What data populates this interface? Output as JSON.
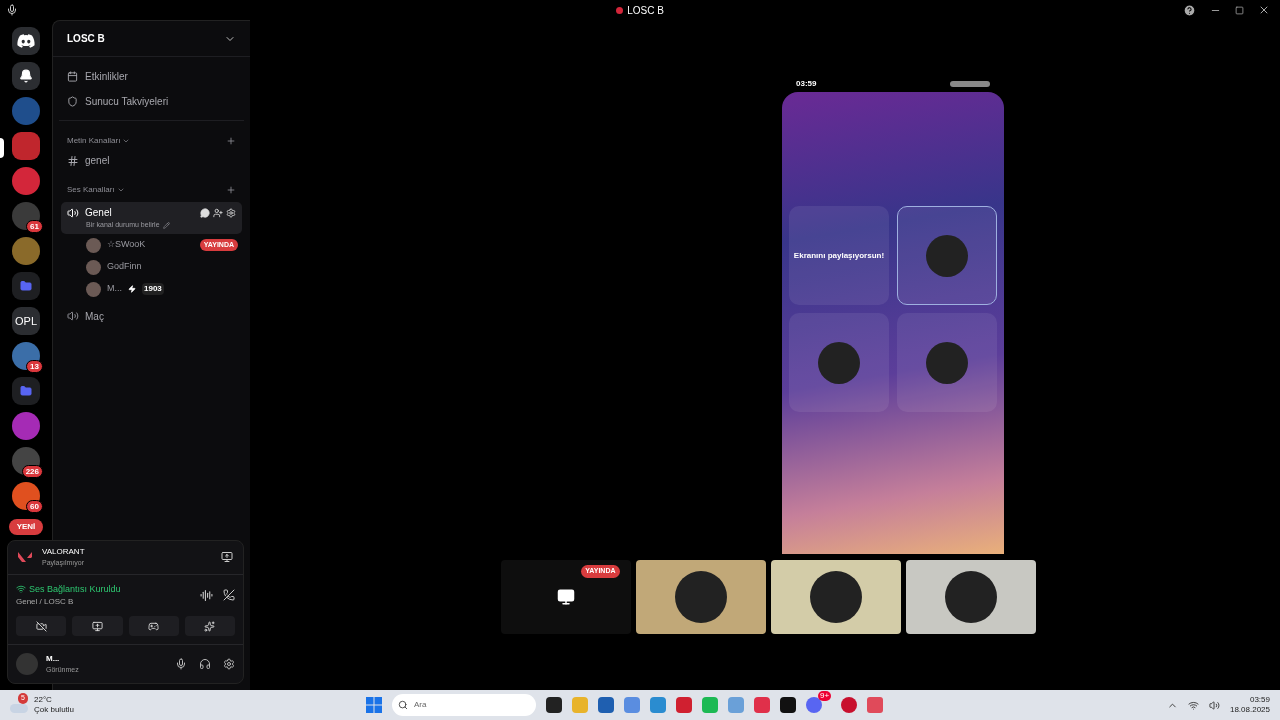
{
  "window": {
    "title": "LOSC B"
  },
  "servers": [
    {
      "kind": "logo",
      "selected": false,
      "color": "#2b2d31"
    },
    {
      "kind": "bell",
      "selected": false,
      "color": "#2b2d31"
    },
    {
      "kind": "image",
      "selected": false,
      "color": "#1f4e8c"
    },
    {
      "kind": "image",
      "selected": true,
      "color": "#c0262d"
    },
    {
      "kind": "image",
      "selected": false,
      "color": "#d3263a"
    },
    {
      "kind": "image",
      "badge": "61",
      "selected": false,
      "color": "#3a3a3a"
    },
    {
      "kind": "image",
      "selected": false,
      "color": "#8a6a2a"
    },
    {
      "kind": "folder",
      "selected": false,
      "color": "#1e1f22"
    },
    {
      "kind": "text",
      "label": "OPL",
      "selected": false,
      "color": "#2b2d31"
    },
    {
      "kind": "image",
      "badge": "13",
      "selected": false,
      "color": "#3b6ea8"
    },
    {
      "kind": "folder",
      "selected": false,
      "color": "#1e1f22"
    },
    {
      "kind": "image",
      "selected": false,
      "color": "#a52bb5"
    },
    {
      "kind": "image",
      "badge": "226",
      "selected": false,
      "color": "#444444"
    },
    {
      "kind": "image",
      "badge": "60",
      "selected": false,
      "color": "#e0501f"
    }
  ],
  "new_pill": "YENİ",
  "sidebar": {
    "server_name": "LOSC B",
    "top_items": [
      {
        "kind": "events",
        "label": "Etkinlikler"
      },
      {
        "kind": "boost",
        "label": "Sunucu Takviyeleri"
      }
    ],
    "text_category": "Metin Kanalları",
    "text_channels": [
      {
        "name": "genel"
      }
    ],
    "voice_category": "Ses Kanalları",
    "voice_channels": [
      {
        "name": "Genel",
        "selected": true,
        "status": "Bir kanal durumu belirle",
        "users": [
          {
            "name": "☆SWooK",
            "live": "YAYINDA"
          },
          {
            "name": "GodFinn"
          },
          {
            "name": "M...",
            "tag": "1903"
          }
        ]
      },
      {
        "name": "Maç",
        "selected": false
      }
    ]
  },
  "activity": {
    "game": "VALORANT",
    "status": "Paylaşılmıyor"
  },
  "voice_panel": {
    "state": "Ses Bağlantısı Kuruldu",
    "channel": "Genel / LOSC B"
  },
  "user": {
    "name": "M...",
    "status": "Görünmez"
  },
  "phone": {
    "time": "03:59",
    "tiles": [
      {
        "kind": "share",
        "text": "Ekranını paylaşıyorsun!",
        "selected": false
      },
      {
        "kind": "avatar",
        "selected": true
      },
      {
        "kind": "avatar",
        "selected": false
      },
      {
        "kind": "avatar",
        "selected": false
      }
    ]
  },
  "streams": [
    {
      "kind": "screen",
      "badge": "YAYINDA",
      "color": "#0e0e0e"
    },
    {
      "kind": "avatar",
      "color": "#c1a878"
    },
    {
      "kind": "avatar",
      "color": "#d3cca8"
    },
    {
      "kind": "avatar",
      "color": "#c8c8c2"
    }
  ],
  "taskbar": {
    "temperature": "22°C",
    "weather": "Çok bulutlu",
    "weather_badge": "5",
    "search_placeholder": "Ara",
    "discord_badge": "9+",
    "time": "03:59",
    "date": "18.08.2025"
  }
}
